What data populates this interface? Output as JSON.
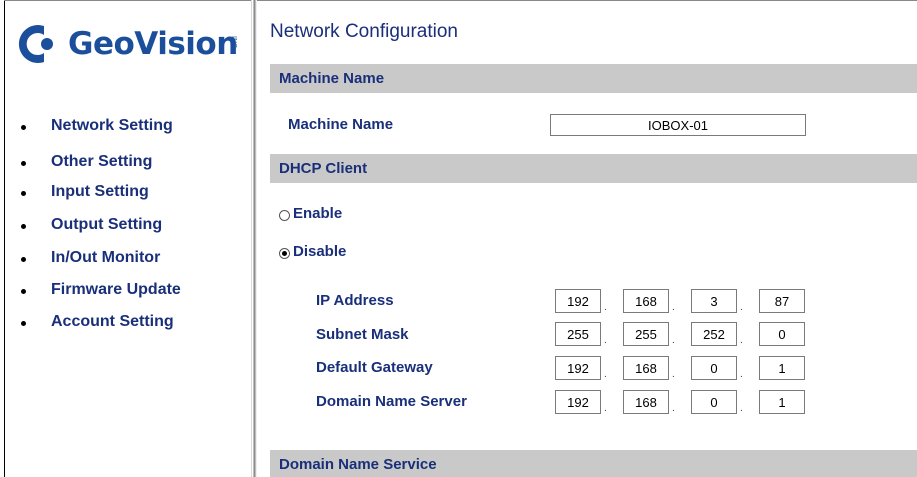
{
  "logo": {
    "text": "GeoVision",
    "sup": "INC"
  },
  "nav": {
    "items": [
      {
        "label": "Network Setting"
      },
      {
        "label": "Other Setting"
      },
      {
        "label": "Input Setting"
      },
      {
        "label": "Output Setting"
      },
      {
        "label": "In/Out Monitor"
      },
      {
        "label": "Firmware Update"
      },
      {
        "label": "Account Setting"
      }
    ]
  },
  "main": {
    "title": "Network Configuration",
    "machine_section": {
      "header": "Machine Name",
      "label": "Machine Name",
      "value": "IOBOX-01"
    },
    "dhcp_section": {
      "header": "DHCP Client",
      "enable_label": "Enable",
      "disable_label": "Disable",
      "selected": "disable"
    },
    "ip_fields": [
      {
        "label": "IP Address",
        "octets": [
          "192",
          "168",
          "3",
          "87"
        ]
      },
      {
        "label": "Subnet Mask",
        "octets": [
          "255",
          "255",
          "252",
          "0"
        ]
      },
      {
        "label": "Default Gateway",
        "octets": [
          "192",
          "168",
          "0",
          "1"
        ]
      },
      {
        "label": "Domain Name Server",
        "octets": [
          "192",
          "168",
          "0",
          "1"
        ]
      }
    ],
    "dns_section": {
      "header": "Domain Name Service"
    }
  },
  "colors": {
    "link": "#1a2f7a",
    "logo": "#1b4f9c",
    "section_bg": "#c9c9c9"
  }
}
